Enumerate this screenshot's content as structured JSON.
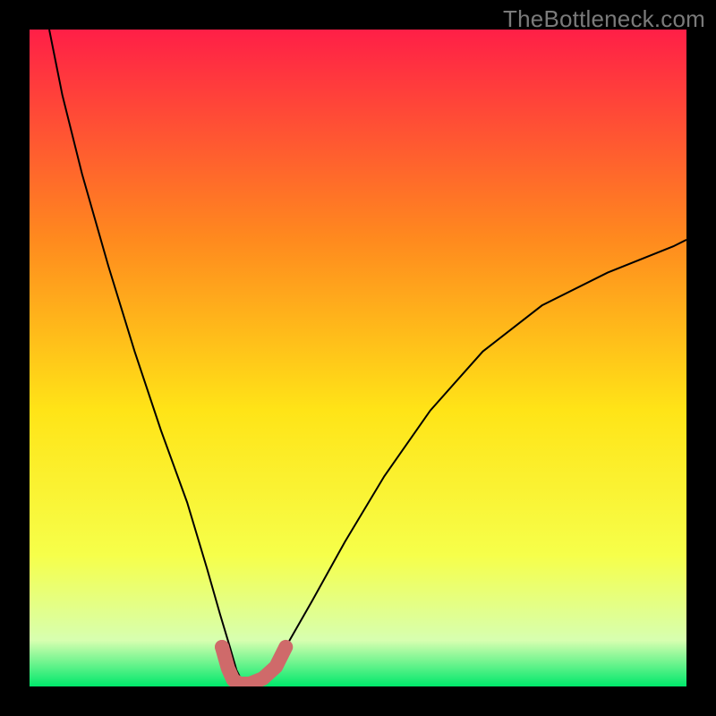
{
  "watermark": "TheBottleneck.com",
  "chart_data": {
    "type": "line",
    "title": "",
    "xlabel": "",
    "ylabel": "",
    "xlim": [
      0,
      100
    ],
    "ylim": [
      0,
      100
    ],
    "background_gradient": {
      "top": "#ff1f47",
      "mid_upper": "#ff8a1e",
      "mid": "#ffe417",
      "mid_lower": "#f6ff4a",
      "low": "#d7ffb0",
      "bottom": "#00e86b"
    },
    "series": [
      {
        "name": "bottleneck-curve",
        "color": "#000000",
        "stroke_width": 2,
        "x": [
          3,
          5,
          8,
          12,
          16,
          20,
          24,
          27,
          29,
          30.5,
          31.5,
          32.5,
          34,
          36,
          39,
          43,
          48,
          54,
          61,
          69,
          78,
          88,
          98,
          100
        ],
        "y": [
          100,
          90,
          78,
          64,
          51,
          39,
          28,
          18,
          11,
          6,
          2.5,
          0.5,
          0.5,
          2,
          6,
          13,
          22,
          32,
          42,
          51,
          58,
          63,
          67,
          68
        ]
      }
    ],
    "highlight": {
      "name": "optimal-zone",
      "color": "#cf6a6a",
      "stroke_width": 16,
      "x": [
        29.3,
        30.2,
        31.0,
        32.0,
        33.5,
        35.5,
        37.5,
        39.0
      ],
      "y": [
        6.0,
        2.8,
        1.0,
        0.4,
        0.4,
        1.2,
        3.0,
        6.0
      ]
    },
    "highlight_dot": {
      "x": 29.3,
      "y": 6.0,
      "r": 8,
      "color": "#cf6a6a"
    }
  }
}
